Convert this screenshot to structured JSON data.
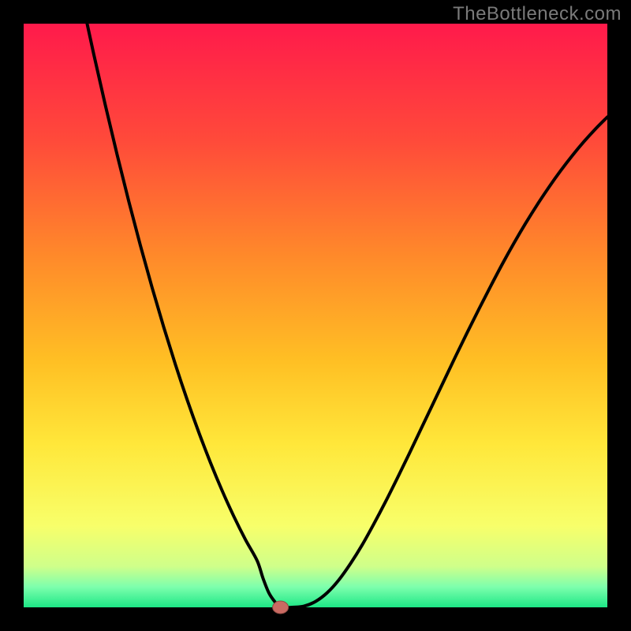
{
  "watermark": "TheBottleneck.com",
  "colors": {
    "border": "#000000",
    "curve": "#000000",
    "marker_fill": "#c96a62",
    "marker_stroke": "#8f4a43",
    "gradient_stops": [
      {
        "offset": 0.0,
        "color": "#ff1a4b"
      },
      {
        "offset": 0.2,
        "color": "#ff4a3a"
      },
      {
        "offset": 0.4,
        "color": "#ff8a2a"
      },
      {
        "offset": 0.58,
        "color": "#ffc024"
      },
      {
        "offset": 0.72,
        "color": "#ffe73a"
      },
      {
        "offset": 0.86,
        "color": "#f8ff6a"
      },
      {
        "offset": 0.93,
        "color": "#cfff8a"
      },
      {
        "offset": 0.965,
        "color": "#7dffad"
      },
      {
        "offset": 1.0,
        "color": "#1de786"
      }
    ]
  },
  "chart_data": {
    "type": "line",
    "title": "",
    "xlabel": "",
    "ylabel": "",
    "xlim": [
      0,
      100
    ],
    "ylim": [
      0,
      100
    ],
    "grid": false,
    "x": [
      0,
      2,
      4,
      6,
      8,
      10,
      12,
      14,
      16,
      18,
      20,
      22,
      24,
      26,
      28,
      30,
      32,
      34,
      36,
      38,
      40,
      41,
      42,
      43,
      44,
      46,
      48,
      50,
      52,
      54,
      56,
      58,
      60,
      62,
      64,
      66,
      68,
      70,
      72,
      74,
      76,
      78,
      80,
      82,
      84,
      86,
      88,
      90,
      92,
      94,
      96,
      98,
      100
    ],
    "values": [
      156,
      145,
      134,
      123.5,
      113.5,
      104,
      94.8,
      86,
      77.6,
      69.6,
      62,
      54.8,
      48,
      41.6,
      35.6,
      30,
      24.8,
      20,
      15.6,
      11.6,
      8,
      5,
      2.5,
      1,
      0,
      0,
      0.2,
      1,
      2.5,
      4.7,
      7.5,
      10.7,
      14.3,
      18.1,
      22.1,
      26.2,
      30.4,
      34.6,
      38.8,
      43,
      47.1,
      51.1,
      55,
      58.8,
      62.4,
      65.8,
      69,
      72,
      74.8,
      77.4,
      79.8,
      82,
      84
    ],
    "marker": {
      "x": 44,
      "y": 0
    },
    "notes": "Axes and units are not labeled in the source image; x and y are given in percentage of the plotting area (0–100). Values above 100 on the left branch extend beyond the top of the visible frame (the curve runs off the top-left)."
  }
}
